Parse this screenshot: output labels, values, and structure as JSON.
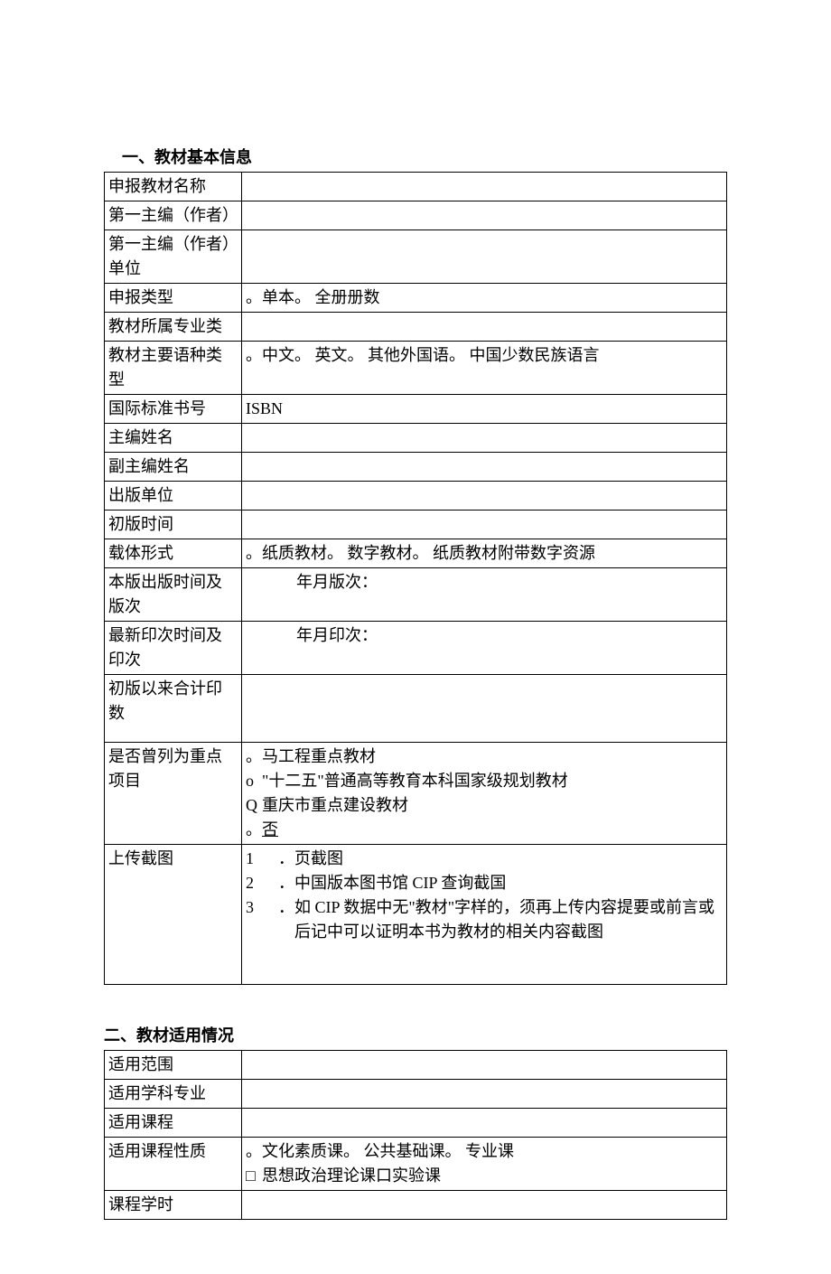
{
  "section1": {
    "title": "一、教材基本信息",
    "rows": {
      "name_label": "申报教材名称",
      "author_label": "第一主编（作者）",
      "author_unit_label": "第一主编（作者）单位",
      "type_label": "申报类型",
      "type_opts": [
        "单本。",
        "全册册数"
      ],
      "major_label": "教材所属专业类",
      "lang_label": "教材主要语种类型",
      "lang_opts": [
        "中文。",
        "英文。",
        "其他外国语。",
        "中国少数民族语言"
      ],
      "isbn_label": "国际标准书号",
      "isbn_value": "ISBN",
      "editor_label": "主编姓名",
      "sub_editor_label": "副主编姓名",
      "publisher_label": "出版单位",
      "first_pub_label": "初版时间",
      "medium_label": "载体形式",
      "medium_opts": [
        "纸质教材。",
        "数字教材。",
        "纸质教材附带数字资源"
      ],
      "edition_label": "本版出版时间及版次",
      "edition_value": "年月版次：",
      "print_label": "最新印次时间及印次",
      "print_value": "年月印次：",
      "total_print_label": "初版以来合计印数",
      "key_proj_label": "是否曾列为重点项目",
      "key_proj_opts": {
        "a": "马工程重点教材",
        "b": "\"十二五\"普通高等教育本科国家级规划教材",
        "c_marker": "Q",
        "c": "重庆市重点建设教材",
        "d": "否"
      },
      "screenshot_label": "上传截图",
      "screenshot_items": {
        "n1": "1",
        "t1": "页截图",
        "n2": "2",
        "t2": "中国版本图书馆 CIP 查询截国",
        "n3": "3",
        "t3": "如 CIP 数据中无\"教材\"字样的，须再上传内容提要或前言或后记中可以证明本书为教材的相关内容截图"
      }
    }
  },
  "section2": {
    "title": "二、教材适用情况",
    "rows": {
      "scope_label": "适用范围",
      "subject_label": "适用学科专业",
      "course_label": "适用课程",
      "course_type_label": "适用课程性质",
      "course_type_line1": [
        "文化素质课。",
        "公共基础课。",
        "专业课"
      ],
      "course_type_line2_a_marker": "□",
      "course_type_line2_a": "思想政治理论课",
      "course_type_line2_b_marker": "口",
      "course_type_line2_b": "实验课",
      "hours_label": "课程学时"
    }
  }
}
